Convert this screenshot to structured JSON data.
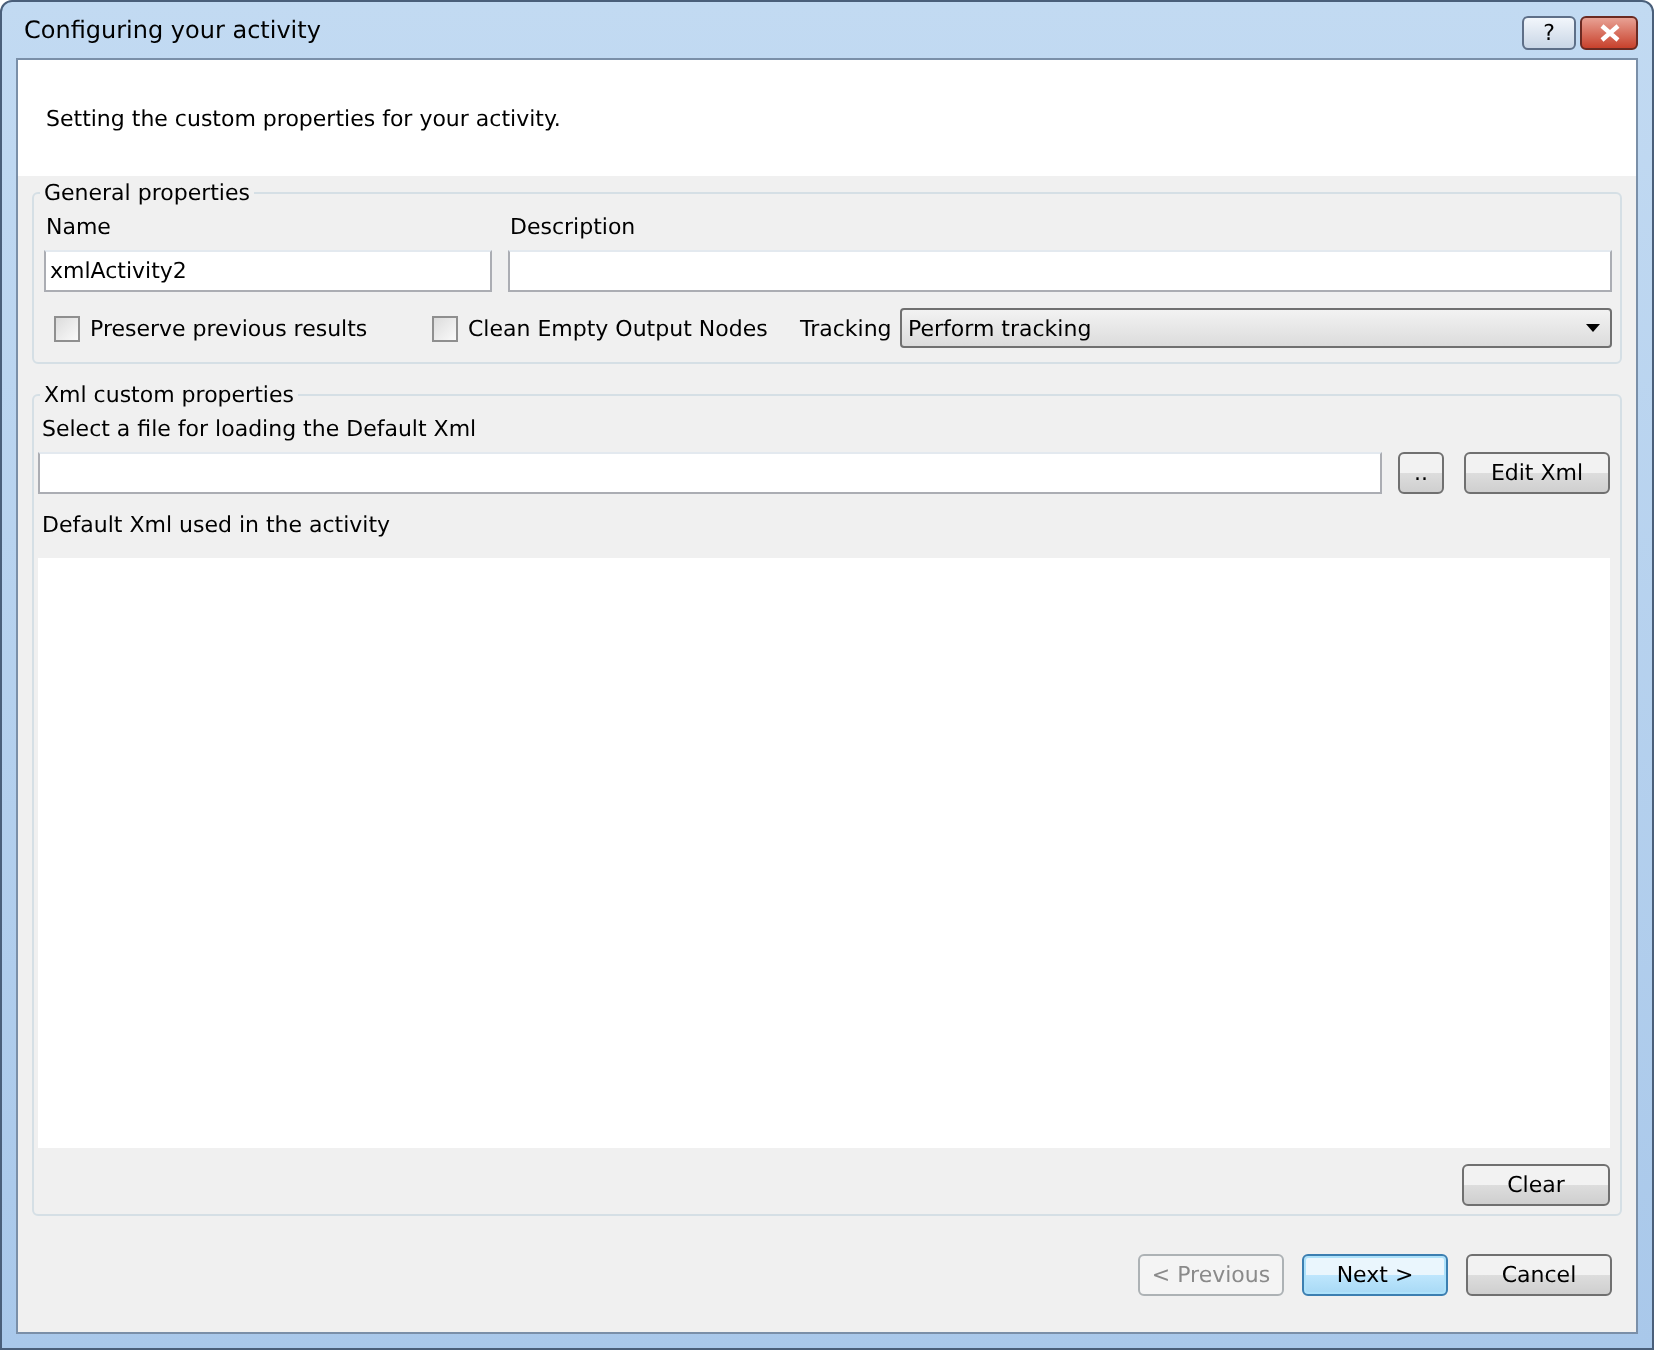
{
  "window": {
    "title": "Configuring your activity",
    "title_buttons": [
      "?"
    ]
  },
  "header": {
    "text": "Setting the custom properties for your activity."
  },
  "general": {
    "legend": "General properties",
    "name_label": "Name",
    "name_value": "xmlActivity2",
    "description_label": "Description",
    "checkboxes": [
      {
        "label": "Preserve previous results",
        "checked": false
      },
      {
        "label": "Clean Empty Output Nodes",
        "checked": false
      }
    ],
    "tracking_label": "Tracking",
    "tracking_value": "Perform tracking"
  },
  "xml": {
    "legend": "Xml custom properties",
    "file_label": "Select a file for loading the Default Xml",
    "browse_button": "..",
    "edit_button": "Edit Xml",
    "default_label": "Default Xml used in the activity",
    "clear_button": "Clear"
  },
  "buttons": [
    {
      "label": "< Previous",
      "disabled": true,
      "default": false
    },
    {
      "label": "Next >",
      "disabled": false,
      "default": true
    },
    {
      "label": "Cancel",
      "disabled": false,
      "default": false
    }
  ]
}
